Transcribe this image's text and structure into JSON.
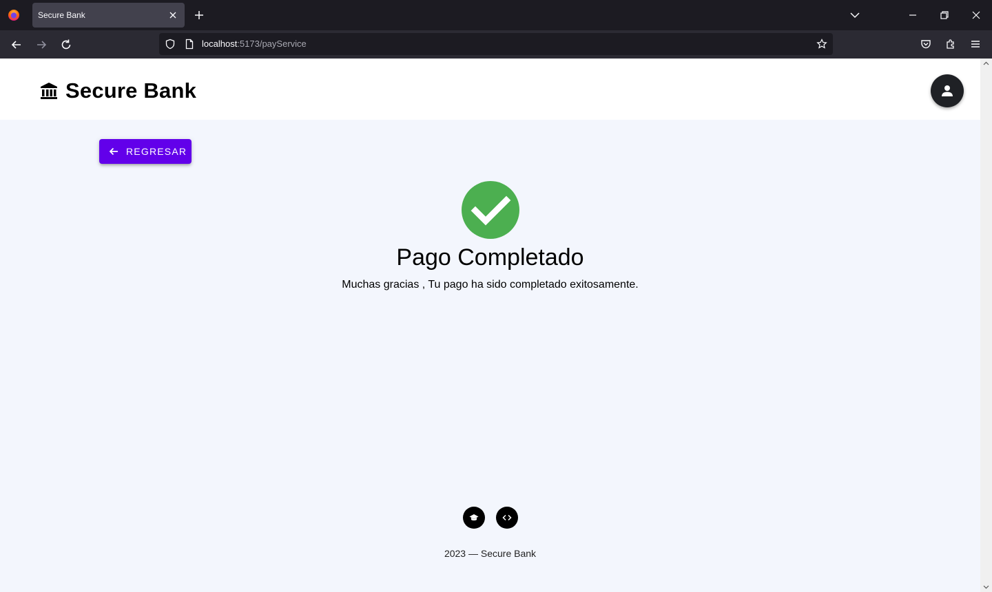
{
  "browser": {
    "tab_title": "Secure Bank",
    "url_host": "localhost",
    "url_rest": ":5173/payService"
  },
  "header": {
    "brand": "Secure Bank"
  },
  "back_button": {
    "label": "REGRESAR"
  },
  "result": {
    "title": "Pago Completado",
    "message": "Muchas gracias , Tu pago ha sido completado exitosamente."
  },
  "footer": {
    "copyright": "2023 — Secure Bank"
  },
  "colors": {
    "accent": "#6200ea",
    "success": "#4caf50",
    "page_bg": "#f3f6fd"
  }
}
